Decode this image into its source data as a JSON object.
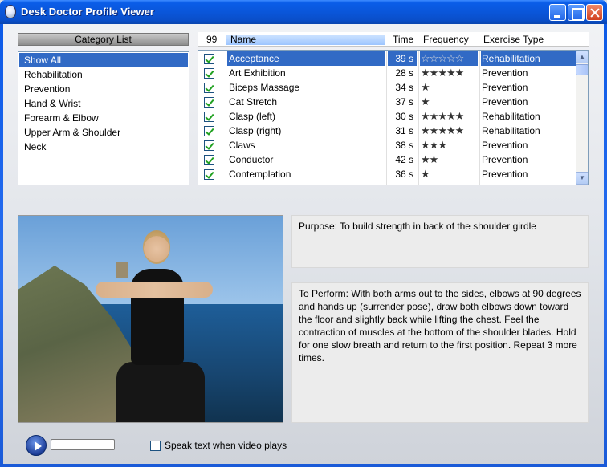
{
  "window": {
    "title": "Desk Doctor Profile Viewer"
  },
  "category_list": {
    "header": "Category List",
    "items": [
      {
        "label": "Show All",
        "selected": true
      },
      {
        "label": "Rehabilitation",
        "selected": false
      },
      {
        "label": "Prevention",
        "selected": false
      },
      {
        "label": "Hand & Wrist",
        "selected": false
      },
      {
        "label": "Forearm & Elbow",
        "selected": false
      },
      {
        "label": "Upper Arm & Shoulder",
        "selected": false
      },
      {
        "label": "Neck",
        "selected": false
      }
    ]
  },
  "exercise_table": {
    "columns": {
      "count": "99",
      "name": "Name",
      "time": "Time",
      "frequency": "Frequency",
      "type": "Exercise Type"
    },
    "rows": [
      {
        "name": "Acceptance",
        "time": "39 s",
        "stars": 5,
        "type": "Rehabilitation",
        "checked": true,
        "selected": true
      },
      {
        "name": "Art Exhibition",
        "time": "28 s",
        "stars": 5,
        "type": "Prevention",
        "checked": true,
        "selected": false
      },
      {
        "name": "Biceps Massage",
        "time": "34 s",
        "stars": 1,
        "type": "Prevention",
        "checked": true,
        "selected": false
      },
      {
        "name": "Cat Stretch",
        "time": "37 s",
        "stars": 1,
        "type": "Prevention",
        "checked": true,
        "selected": false
      },
      {
        "name": "Clasp (left)",
        "time": "30 s",
        "stars": 5,
        "type": "Rehabilitation",
        "checked": true,
        "selected": false
      },
      {
        "name": "Clasp (right)",
        "time": "31 s",
        "stars": 5,
        "type": "Rehabilitation",
        "checked": true,
        "selected": false
      },
      {
        "name": "Claws",
        "time": "38 s",
        "stars": 3,
        "type": "Prevention",
        "checked": true,
        "selected": false
      },
      {
        "name": "Conductor",
        "time": "42 s",
        "stars": 2,
        "type": "Prevention",
        "checked": true,
        "selected": false
      },
      {
        "name": "Contemplation",
        "time": "36 s",
        "stars": 1,
        "type": "Prevention",
        "checked": true,
        "selected": false
      }
    ]
  },
  "details": {
    "purpose": "Purpose: To build strength in back of the shoulder girdle",
    "perform": "To Perform: With both arms out to the sides, elbows at 90 degrees and hands up (surrender pose), draw both elbows down toward the floor and slightly back while lifting the chest. Feel the contraction of muscles at the bottom of the shoulder blades.  Hold for one slow breath and return to the first position. Repeat 3 more times."
  },
  "controls": {
    "speak_label": "Speak text when video plays",
    "speak_checked": false,
    "progress": 0
  },
  "icons": {
    "app": "app-icon",
    "minimize": "minimize-icon",
    "maximize": "maximize-icon",
    "close": "close-icon",
    "play": "play-icon",
    "star": "star-icon"
  },
  "colors": {
    "selection": "#316ac5",
    "titlebar": "#0a55d8",
    "check": "#21a121"
  }
}
